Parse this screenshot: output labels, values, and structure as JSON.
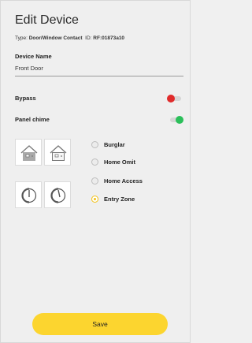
{
  "header": {
    "title": "Edit Device"
  },
  "device_meta": {
    "type_label": "Type:",
    "type_value": "Door/Window Contact",
    "id_label": "ID:",
    "id_value": "RF:01873a10"
  },
  "device_name": {
    "label": "Device Name",
    "value": "Front Door"
  },
  "bypass": {
    "label": "Bypass",
    "enabled": false,
    "knob_color": "#e02b2b"
  },
  "panel_chime": {
    "label": "Panel chime",
    "enabled": true,
    "knob_color": "#2bbf5a"
  },
  "zone_icons": [
    "house-closed-icon",
    "house-open-icon",
    "contact-closed-icon",
    "contact-open-icon"
  ],
  "zone_options": [
    {
      "label": "Burglar",
      "selected": false
    },
    {
      "label": "Home Omit",
      "selected": false
    },
    {
      "label": "Home Access",
      "selected": false
    },
    {
      "label": "Entry Zone",
      "selected": true
    }
  ],
  "actions": {
    "save_label": "Save"
  },
  "colors": {
    "accent": "#fcd52f",
    "radio_selected": "#f2c21a"
  }
}
